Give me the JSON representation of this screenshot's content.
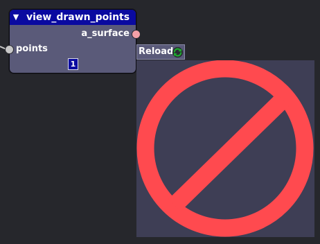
{
  "node": {
    "title": "view_drawn_points",
    "collapse_icon": "triangle-down-icon",
    "output_socket_label": "a_surface",
    "input_socket_label": "points",
    "count_value": "1"
  },
  "reload": {
    "label": "Reload",
    "icon": "refresh-icon"
  },
  "preview": {
    "icon": "prohibited-icon"
  },
  "colors": {
    "canvas_bg": "#26272c",
    "node_bg": "#5a5a79",
    "header_bg": "#0a0aa0",
    "output_socket": "#f4a0a8",
    "input_socket": "#c8c8c8",
    "prohibited_red": "#ff4a4f",
    "preview_bg": "#3e3e55",
    "refresh_green": "#1eaa2e"
  }
}
